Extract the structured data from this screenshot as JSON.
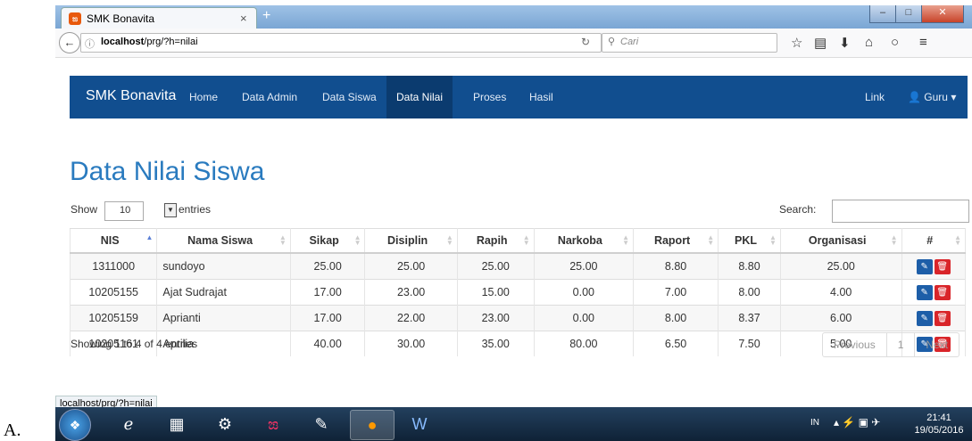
{
  "page_label": "A.",
  "browser": {
    "tab_title": "SMK Bonavita",
    "tab_close": "×",
    "tab_new": "+",
    "url_info": "ⓘ",
    "url_host": "localhost",
    "url_path": "/prg/?h=nilai",
    "search_placeholder": "Cari",
    "status_url": "localhost/prg/?h=nilai"
  },
  "navbar": {
    "brand": "SMK Bonavita",
    "items": [
      "Home",
      "Data Admin",
      "Data Siswa",
      "Data Nilai",
      "Proses",
      "Hasil"
    ],
    "active": "Data Nilai",
    "right_link": "Link",
    "user": "Guru"
  },
  "content": {
    "title": "Data Nilai Siswa",
    "show_label": "Show",
    "entries_value": "10",
    "entries_label": "entries",
    "search_label": "Search:",
    "columns": [
      "NIS",
      "Nama Siswa",
      "Sikap",
      "Disiplin",
      "Rapih",
      "Narkoba",
      "Raport",
      "PKL",
      "Organisasi",
      "#"
    ],
    "rows": [
      [
        "1311000",
        "sundoyo",
        "25.00",
        "25.00",
        "25.00",
        "25.00",
        "8.80",
        "8.80",
        "25.00"
      ],
      [
        "10205155",
        "Ajat Sudrajat",
        "17.00",
        "23.00",
        "15.00",
        "0.00",
        "7.00",
        "8.00",
        "4.00"
      ],
      [
        "10205159",
        "Aprianti",
        "17.00",
        "22.00",
        "23.00",
        "0.00",
        "8.00",
        "8.37",
        "6.00"
      ],
      [
        "10205161",
        "Aprilia",
        "40.00",
        "30.00",
        "35.00",
        "80.00",
        "6.50",
        "7.50",
        "5.00"
      ]
    ],
    "info": "Showing 1 to 4 of 4 entries",
    "pager": {
      "previous": "Previous",
      "page": "1",
      "next": "Next"
    }
  },
  "taskbar": {
    "lang": "IN",
    "time": "21:41",
    "date": "19/05/2016"
  },
  "colors": {
    "navbar": "#114e8f",
    "title": "#2a7bbf",
    "edit": "#1d5ea8",
    "delete": "#d9252a"
  }
}
